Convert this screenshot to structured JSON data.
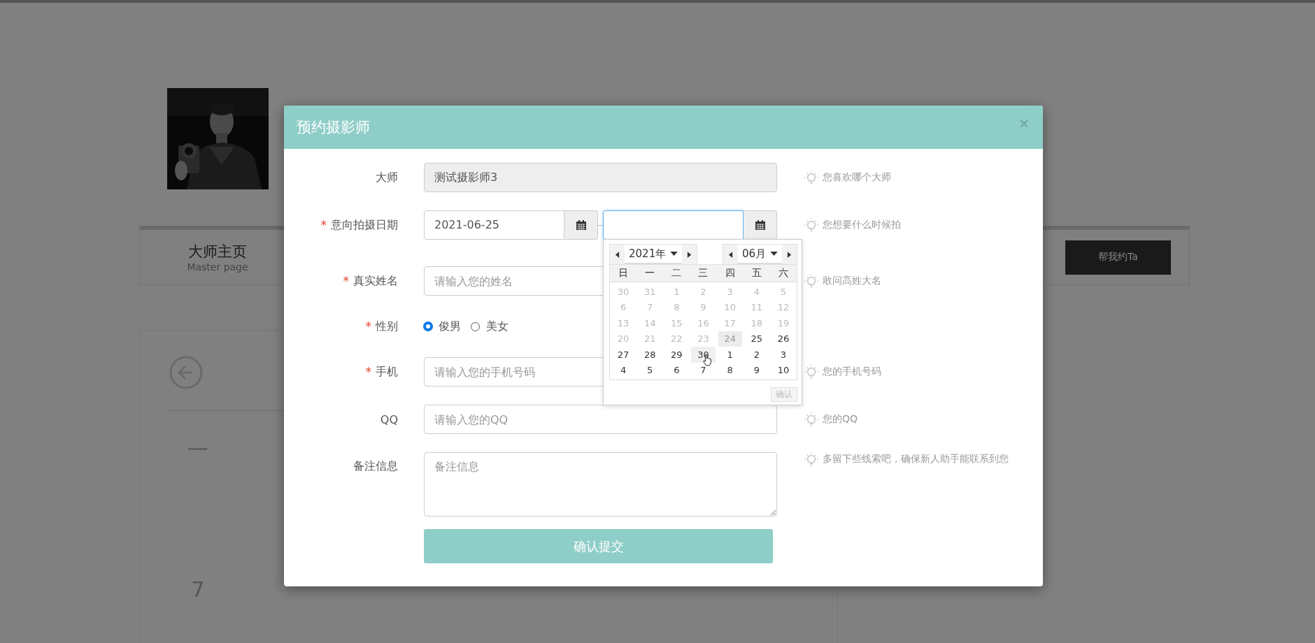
{
  "background_page": {
    "tab": {
      "title": "大师主页",
      "subtitle": "Master page"
    },
    "book_button": "帮我约Ta",
    "calendar": {
      "weekday": "一",
      "dates": [
        "7"
      ]
    }
  },
  "modal": {
    "title": "预约摄影师",
    "fields": [
      {
        "kind": "text",
        "label": "大师",
        "value": "测试摄影师3",
        "disabled": true,
        "hint": "您喜欢哪个大师"
      },
      {
        "kind": "date-range",
        "label": "意向拍摄日期",
        "required_mark": "*",
        "start_value": "2021-06-25",
        "end_focused": true,
        "hint": "您想要什么时候拍"
      },
      {
        "kind": "text",
        "label": "真实姓名",
        "required_mark": "*",
        "placeholder": "请输入您的姓名",
        "disabled": false,
        "hint": "敢问高姓大名"
      },
      {
        "kind": "radio",
        "label": "性别",
        "required_mark": "*",
        "options": [
          {
            "label": "俊男",
            "selected": true
          },
          {
            "label": "美女",
            "selected": false
          }
        ]
      },
      {
        "kind": "text",
        "label": "手机",
        "required_mark": "*",
        "placeholder": "请输入您的手机号码",
        "disabled": false,
        "hint": "您的手机号码"
      },
      {
        "kind": "text",
        "label": "QQ",
        "placeholder": "请输入您的QQ",
        "disabled": false,
        "hint": "您的QQ"
      },
      {
        "kind": "textarea",
        "label": "备注信息",
        "placeholder": "备注信息",
        "hint": "多留下些线索吧，确保新人助手能联系到您"
      }
    ],
    "submit_button": "确认提交"
  },
  "date_picker": {
    "year": "2021年",
    "month": "06月",
    "weekdays": [
      "日",
      "一",
      "二",
      "三",
      "四",
      "五",
      "六"
    ],
    "weeks": [
      [
        {
          "day": "30",
          "disabled": true,
          "highlighted": false,
          "hovered": false
        },
        {
          "day": "31",
          "disabled": true,
          "highlighted": false,
          "hovered": false
        },
        {
          "day": "1",
          "disabled": true,
          "highlighted": false,
          "hovered": false
        },
        {
          "day": "2",
          "disabled": true,
          "highlighted": false,
          "hovered": false
        },
        {
          "day": "3",
          "disabled": true,
          "highlighted": false,
          "hovered": false
        },
        {
          "day": "4",
          "disabled": true,
          "highlighted": false,
          "hovered": false
        },
        {
          "day": "5",
          "disabled": true,
          "highlighted": false,
          "hovered": false
        }
      ],
      [
        {
          "day": "6",
          "disabled": true,
          "highlighted": false,
          "hovered": false
        },
        {
          "day": "7",
          "disabled": true,
          "highlighted": false,
          "hovered": false
        },
        {
          "day": "8",
          "disabled": true,
          "highlighted": false,
          "hovered": false
        },
        {
          "day": "9",
          "disabled": true,
          "highlighted": false,
          "hovered": false
        },
        {
          "day": "10",
          "disabled": true,
          "highlighted": false,
          "hovered": false
        },
        {
          "day": "11",
          "disabled": true,
          "highlighted": false,
          "hovered": false
        },
        {
          "day": "12",
          "disabled": true,
          "highlighted": false,
          "hovered": false
        }
      ],
      [
        {
          "day": "13",
          "disabled": true,
          "highlighted": false,
          "hovered": false
        },
        {
          "day": "14",
          "disabled": true,
          "highlighted": false,
          "hovered": false
        },
        {
          "day": "15",
          "disabled": true,
          "highlighted": false,
          "hovered": false
        },
        {
          "day": "16",
          "disabled": true,
          "highlighted": false,
          "hovered": false
        },
        {
          "day": "17",
          "disabled": true,
          "highlighted": false,
          "hovered": false
        },
        {
          "day": "18",
          "disabled": true,
          "highlighted": false,
          "hovered": false
        },
        {
          "day": "19",
          "disabled": true,
          "highlighted": false,
          "hovered": false
        }
      ],
      [
        {
          "day": "20",
          "disabled": true,
          "highlighted": false,
          "hovered": false
        },
        {
          "day": "21",
          "disabled": true,
          "highlighted": false,
          "hovered": false
        },
        {
          "day": "22",
          "disabled": true,
          "highlighted": false,
          "hovered": false
        },
        {
          "day": "23",
          "disabled": true,
          "highlighted": false,
          "hovered": false
        },
        {
          "day": "24",
          "disabled": true,
          "highlighted": true,
          "hovered": false
        },
        {
          "day": "25",
          "disabled": false,
          "highlighted": false,
          "hovered": false
        },
        {
          "day": "26",
          "disabled": false,
          "highlighted": false,
          "hovered": false
        }
      ],
      [
        {
          "day": "27",
          "disabled": false,
          "highlighted": false,
          "hovered": false
        },
        {
          "day": "28",
          "disabled": false,
          "highlighted": false,
          "hovered": false
        },
        {
          "day": "29",
          "disabled": false,
          "highlighted": false,
          "hovered": false
        },
        {
          "day": "30",
          "disabled": false,
          "highlighted": false,
          "hovered": true
        },
        {
          "day": "1",
          "disabled": false,
          "highlighted": false,
          "hovered": false
        },
        {
          "day": "2",
          "disabled": false,
          "highlighted": false,
          "hovered": false
        },
        {
          "day": "3",
          "disabled": false,
          "highlighted": false,
          "hovered": false
        }
      ],
      [
        {
          "day": "4",
          "disabled": false,
          "highlighted": false,
          "hovered": false
        },
        {
          "day": "5",
          "disabled": false,
          "highlighted": false,
          "hovered": false
        },
        {
          "day": "6",
          "disabled": false,
          "highlighted": false,
          "hovered": false
        },
        {
          "day": "7",
          "disabled": false,
          "highlighted": false,
          "hovered": false
        },
        {
          "day": "8",
          "disabled": false,
          "highlighted": false,
          "hovered": false
        },
        {
          "day": "9",
          "disabled": false,
          "highlighted": false,
          "hovered": false
        },
        {
          "day": "10",
          "disabled": false,
          "highlighted": false,
          "hovered": false
        }
      ]
    ],
    "confirm_button": {
      "label": "确认",
      "disabled": true
    }
  }
}
